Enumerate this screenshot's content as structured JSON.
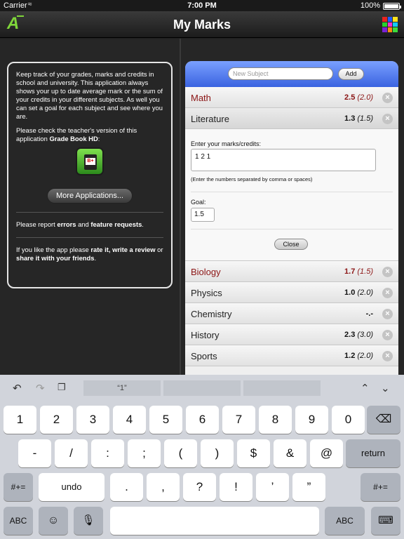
{
  "status_bar": {
    "carrier": "Carrier",
    "time": "7:00 PM",
    "battery": "100%"
  },
  "navbar": {
    "title": "My Marks",
    "logo_letter": "A",
    "grid_colors": [
      "#e8231f",
      "#1e5bff",
      "#ffe21a",
      "#26d12d",
      "#ff2bd4",
      "#12c9ff",
      "#7a22d6",
      "#ff8a10",
      "#3cdc3c"
    ]
  },
  "info": {
    "intro": "Keep track of your grades, marks and credits in school and university. This application always shows your up to date average mark or the sum of your credits in your different subjects. As well you can set a goal for each subject and see where you are.",
    "teacher_prefix": "Please check the teacher's version of this application ",
    "teacher_app": "Grade Book HD",
    "teacher_suffix": ":",
    "more_button": "More Applications...",
    "report_prefix": "Please report ",
    "report_errors": "errors",
    "report_and": " and ",
    "report_features": "feature requests",
    "report_suffix": ".",
    "like_prefix": "If you like the app please ",
    "like_rate": "rate it, write a review",
    "like_or": " or ",
    "like_share": "share it with your friends",
    "like_suffix": "."
  },
  "add_subject": {
    "placeholder": "New Subject",
    "button": "Add"
  },
  "subjects_top": [
    {
      "name": "Math",
      "avg": "2.5",
      "goal": "(2.0)",
      "red": true
    },
    {
      "name": "Literature",
      "avg": "1.3",
      "goal": "(1.5)",
      "red": false
    }
  ],
  "editor": {
    "marks_label": "Enter your marks/credits:",
    "marks_value": "1 2 1",
    "hint": "(Enter the numbers separated by comma or spaces)",
    "goal_label": "Goal:",
    "goal_value": "1.5",
    "close_button": "Close"
  },
  "subjects_bottom": [
    {
      "name": "Biology",
      "avg": "1.7",
      "goal": "(1.5)",
      "red": true
    },
    {
      "name": "Physics",
      "avg": "1.0",
      "goal": "(2.0)",
      "red": false
    },
    {
      "name": "Chemistry",
      "avg": "-.-",
      "goal": "",
      "red": false
    },
    {
      "name": "History",
      "avg": "2.3",
      "goal": "(3.0)",
      "red": false
    },
    {
      "name": "Sports",
      "avg": "1.2",
      "goal": "(2.0)",
      "red": false
    }
  ],
  "keyboard": {
    "suggestion": "“1”",
    "row1": [
      "1",
      "2",
      "3",
      "4",
      "5",
      "6",
      "7",
      "8",
      "9",
      "0"
    ],
    "row2": [
      "-",
      "/",
      ":",
      ";",
      "(",
      ")",
      "$",
      "&",
      "@"
    ],
    "return": "return",
    "row3_left": "#+=",
    "undo": "undo",
    "row3": [
      ".",
      ",",
      "?",
      "!",
      "’",
      "”"
    ],
    "row3_right": "#+=",
    "abc_left": "ABC",
    "abc_right": "ABC"
  }
}
